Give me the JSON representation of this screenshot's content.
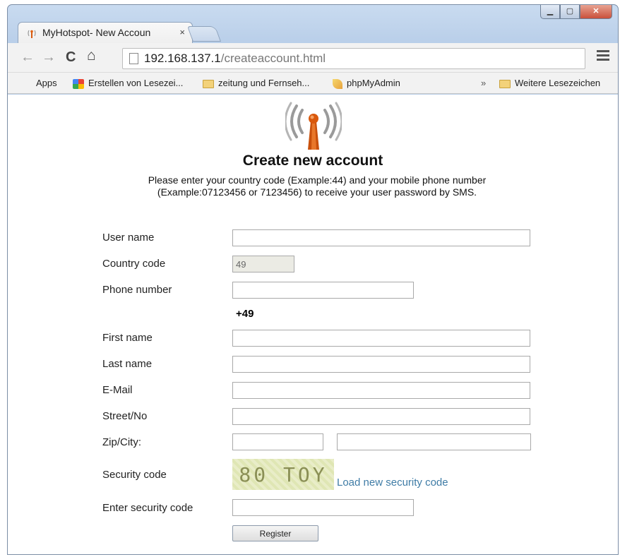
{
  "browser": {
    "tab_title": "MyHotspot- New Accoun",
    "tab_close": "×",
    "url_host": "192.168.137.1",
    "url_path": "/createaccount.html",
    "bookmarks": [
      {
        "label": "Apps"
      },
      {
        "label": "Erstellen von Lesezei..."
      },
      {
        "label": "zeitung und Fernseh..."
      },
      {
        "label": "phpMyAdmin"
      },
      {
        "label": "»"
      },
      {
        "label": "Weitere Lesezeichen"
      }
    ]
  },
  "page": {
    "title": "Create new account",
    "intro_line1": "Please enter your country code (Example:44) and your mobile phone number",
    "intro_line2": "(Example:07123456 or 7123456) to receive your user password by SMS.",
    "labels": {
      "username": "User name",
      "country_code": "Country code",
      "phone": "Phone number",
      "first_name": "First name",
      "last_name": "Last name",
      "email": "E-Mail",
      "street": "Street/No",
      "zip_city": "Zip/City:",
      "security_code": "Security code",
      "enter_security_code": "Enter security code"
    },
    "country_code_value": "49",
    "phone_prefix": "+49",
    "captcha_text": "80 TOY",
    "load_new_code": "Load new security code",
    "register_label": "Register"
  },
  "colors": {
    "link": "#3f7ca6",
    "captcha_bg": "#e4eabf"
  }
}
